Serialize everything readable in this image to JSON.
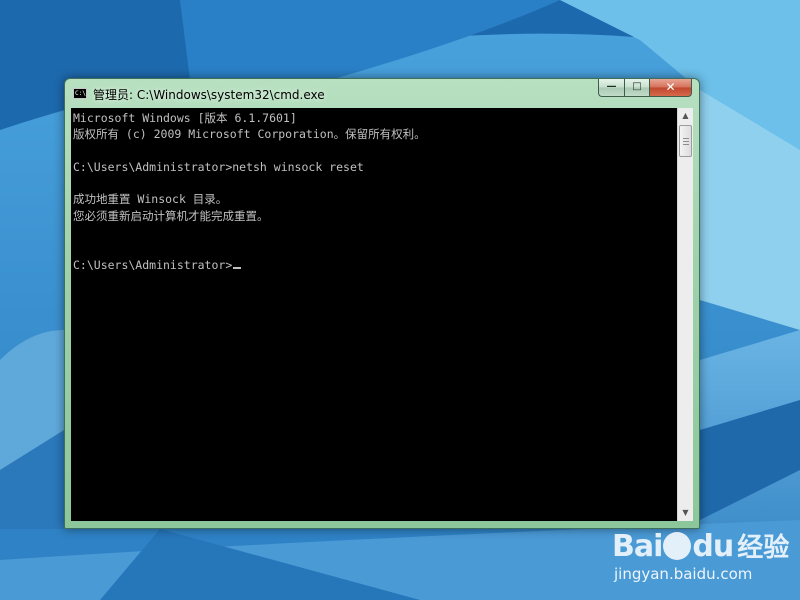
{
  "window": {
    "title": "管理员: C:\\Windows\\system32\\cmd.exe",
    "icon_text": "C:\\",
    "buttons": {
      "minimize": "—",
      "maximize": "□",
      "close": "✕"
    }
  },
  "console": {
    "lines": [
      "Microsoft Windows [版本 6.1.7601]",
      "版权所有 (c) 2009 Microsoft Corporation。保留所有权利。",
      "",
      "C:\\Users\\Administrator>netsh winsock reset",
      "",
      "成功地重置 Winsock 目录。",
      "您必须重新启动计算机才能完成重置。",
      "",
      "",
      "C:\\Users\\Administrator>"
    ],
    "text_color": "#c0c0c0",
    "background": "#000000"
  },
  "scrollbar": {
    "up_arrow": "▲",
    "down_arrow": "▼"
  },
  "watermark": {
    "brand_a": "Bai",
    "brand_b": "du",
    "product": "经验",
    "url": "jingyan.baidu.com"
  }
}
